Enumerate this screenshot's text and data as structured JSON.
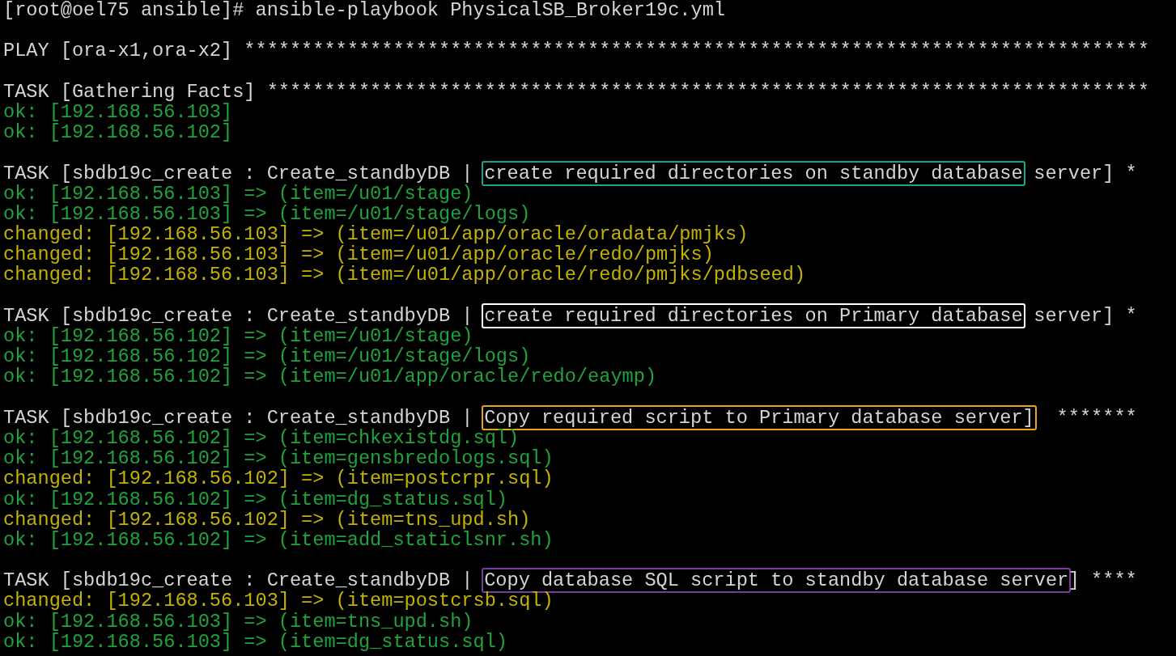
{
  "terminal": {
    "lines": [
      {
        "kind": "output",
        "segments": [
          {
            "text": "[root@oel75 ansible]# ansible-playbook PhysicalSB_Broker19c.yml",
            "color": "#d4d4d4"
          }
        ]
      },
      {
        "kind": "blank"
      },
      {
        "kind": "output",
        "segments": [
          {
            "text": "PLAY [ora-x1,ora-x2] *******************************************************************************",
            "color": "#d4d4d4"
          }
        ]
      },
      {
        "kind": "blank"
      },
      {
        "kind": "output",
        "segments": [
          {
            "text": "TASK [Gathering Facts] *****************************************************************************",
            "color": "#d4d4d4"
          }
        ]
      },
      {
        "kind": "output",
        "segments": [
          {
            "text": "ok: [192.168.56.103]",
            "color": "#1fa33c"
          }
        ]
      },
      {
        "kind": "output",
        "segments": [
          {
            "text": "ok: [192.168.56.102]",
            "color": "#1fa33c"
          }
        ]
      },
      {
        "kind": "blank"
      },
      {
        "kind": "output",
        "segments": [
          {
            "text": "TASK [sbdb19c_create : Create_standbyDB | ",
            "color": "#d4d4d4"
          },
          {
            "text": "create required directories on standby database",
            "color": "#d4d4d4",
            "highlight": {
              "color": "#1aa58a"
            }
          },
          {
            "text": " server] *",
            "color": "#d4d4d4"
          }
        ]
      },
      {
        "kind": "output",
        "segments": [
          {
            "text": "ok: [192.168.56.103] => (item=/u01/stage)",
            "color": "#1fa33c"
          }
        ]
      },
      {
        "kind": "output",
        "segments": [
          {
            "text": "ok: [192.168.56.103] => (item=/u01/stage/logs)",
            "color": "#1fa33c"
          }
        ]
      },
      {
        "kind": "output",
        "segments": [
          {
            "text": "changed: [192.168.56.103] => (item=/u01/app/oracle/oradata/pmjks)",
            "color": "#c4b200"
          }
        ]
      },
      {
        "kind": "output",
        "segments": [
          {
            "text": "changed: [192.168.56.103] => (item=/u01/app/oracle/redo/pmjks)",
            "color": "#c4b200"
          }
        ]
      },
      {
        "kind": "output",
        "segments": [
          {
            "text": "changed: [192.168.56.103] => (item=/u01/app/oracle/redo/pmjks/pdbseed)",
            "color": "#c4b200"
          }
        ]
      },
      {
        "kind": "blank"
      },
      {
        "kind": "output",
        "segments": [
          {
            "text": "TASK [sbdb19c_create : Create_standbyDB | ",
            "color": "#d4d4d4"
          },
          {
            "text": "create required directories on Primary database",
            "color": "#d4d4d4",
            "highlight": {
              "color": "#ffffff"
            }
          },
          {
            "text": " server] *",
            "color": "#d4d4d4"
          }
        ]
      },
      {
        "kind": "output",
        "segments": [
          {
            "text": "ok: [192.168.56.102] => (item=/u01/stage)",
            "color": "#1fa33c"
          }
        ]
      },
      {
        "kind": "output",
        "segments": [
          {
            "text": "ok: [192.168.56.102] => (item=/u01/stage/logs)",
            "color": "#1fa33c"
          }
        ]
      },
      {
        "kind": "output",
        "segments": [
          {
            "text": "ok: [192.168.56.102] => (item=/u01/app/oracle/redo/eaymp)",
            "color": "#1fa33c"
          }
        ]
      },
      {
        "kind": "blank"
      },
      {
        "kind": "output",
        "segments": [
          {
            "text": "TASK [sbdb19c_create : Create_standbyDB | ",
            "color": "#d4d4d4"
          },
          {
            "text": "Copy required script to Primary database server]",
            "color": "#d4d4d4",
            "highlight": {
              "color": "#e8a21c"
            }
          },
          {
            "text": "  *******",
            "color": "#d4d4d4"
          }
        ]
      },
      {
        "kind": "output",
        "segments": [
          {
            "text": "ok: [192.168.56.102] => (item=chkexistdg.sql)",
            "color": "#1fa33c"
          }
        ]
      },
      {
        "kind": "output",
        "segments": [
          {
            "text": "ok: [192.168.56.102] => (item=gensbredologs.sql)",
            "color": "#1fa33c"
          }
        ]
      },
      {
        "kind": "output",
        "segments": [
          {
            "text": "changed: [192.168.56.102] => (item=postcrpr.sql)",
            "color": "#c4b200"
          }
        ]
      },
      {
        "kind": "output",
        "segments": [
          {
            "text": "ok: [192.168.56.102] => (item=dg_status.sql)",
            "color": "#1fa33c"
          }
        ]
      },
      {
        "kind": "output",
        "segments": [
          {
            "text": "changed: [192.168.56.102] => (item=tns_upd.sh)",
            "color": "#c4b200"
          }
        ]
      },
      {
        "kind": "output",
        "segments": [
          {
            "text": "ok: [192.168.56.102] => (item=add_staticlsnr.sh)",
            "color": "#1fa33c"
          }
        ]
      },
      {
        "kind": "blank"
      },
      {
        "kind": "output",
        "segments": [
          {
            "text": "TASK [sbdb19c_create : Create_standbyDB | ",
            "color": "#d4d4d4"
          },
          {
            "text": "Copy database SQL script to standby database server",
            "color": "#d4d4d4",
            "highlight": {
              "color": "#7b3a9c"
            }
          },
          {
            "text": "] ****",
            "color": "#d4d4d4"
          }
        ]
      },
      {
        "kind": "output",
        "segments": [
          {
            "text": "changed: [192.168.56.103] => (item=postcrsb.sql)",
            "color": "#c4b200"
          }
        ]
      },
      {
        "kind": "output",
        "segments": [
          {
            "text": "ok: [192.168.56.103] => (item=tns_upd.sh)",
            "color": "#1fa33c"
          }
        ]
      },
      {
        "kind": "output",
        "segments": [
          {
            "text": "ok: [192.168.56.103] => (item=dg_status.sql)",
            "color": "#1fa33c"
          }
        ]
      }
    ]
  }
}
